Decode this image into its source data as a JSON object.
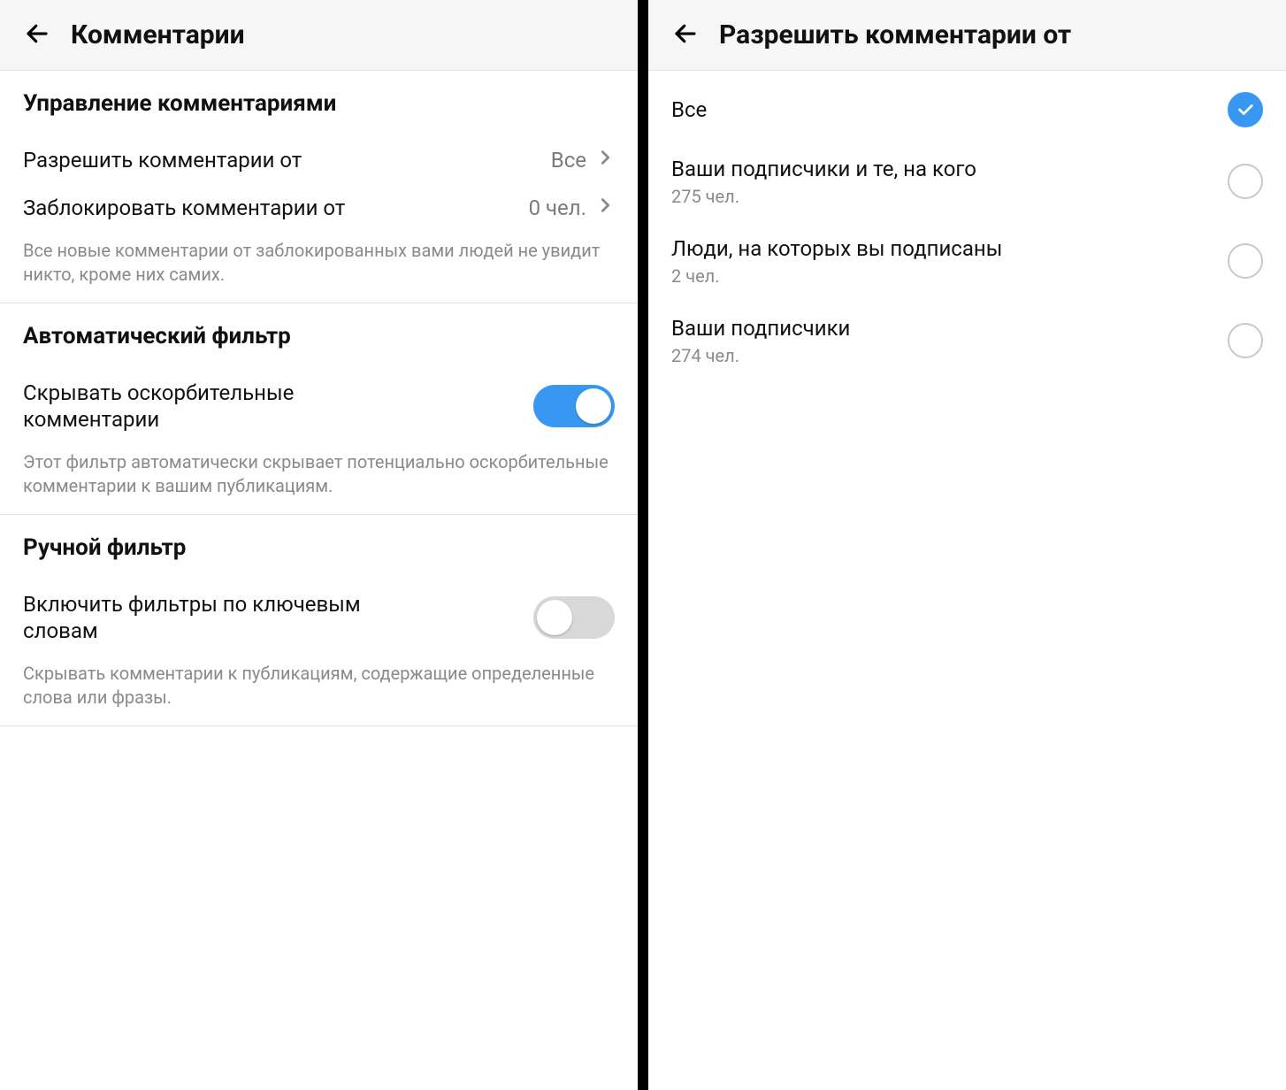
{
  "left": {
    "header_title": "Комментарии",
    "section_manage": {
      "title": "Управление комментариями",
      "allow_from_label": "Разрешить комментарии от",
      "allow_from_value": "Все",
      "block_from_label": "Заблокировать комментарии от",
      "block_from_value": "0 чел.",
      "helper": "Все новые комментарии от заблокированных вами людей не увидит никто, кроме них самих."
    },
    "section_auto": {
      "title": "Автоматический фильтр",
      "hide_offensive_label": "Скрывать оскорбительные комментарии",
      "hide_offensive_on": true,
      "helper": "Этот фильтр автоматически скрывает потенциально оскорбительные комментарии к вашим публикациям."
    },
    "section_manual": {
      "title": "Ручной фильтр",
      "keyword_filter_label": "Включить фильтры по ключевым словам",
      "keyword_filter_on": false,
      "helper": "Скрывать комментарии к публикациям, содержащие определенные слова или фразы."
    }
  },
  "right": {
    "header_title": "Разрешить комментарии от",
    "options": [
      {
        "title": "Все",
        "sub": "",
        "checked": true
      },
      {
        "title": "Ваши подписчики и те, на кого",
        "sub": "275 чел.",
        "checked": false
      },
      {
        "title": "Люди, на которых вы подписаны",
        "sub": "2 чел.",
        "checked": false
      },
      {
        "title": "Ваши подписчики",
        "sub": "274 чел.",
        "checked": false
      }
    ]
  }
}
